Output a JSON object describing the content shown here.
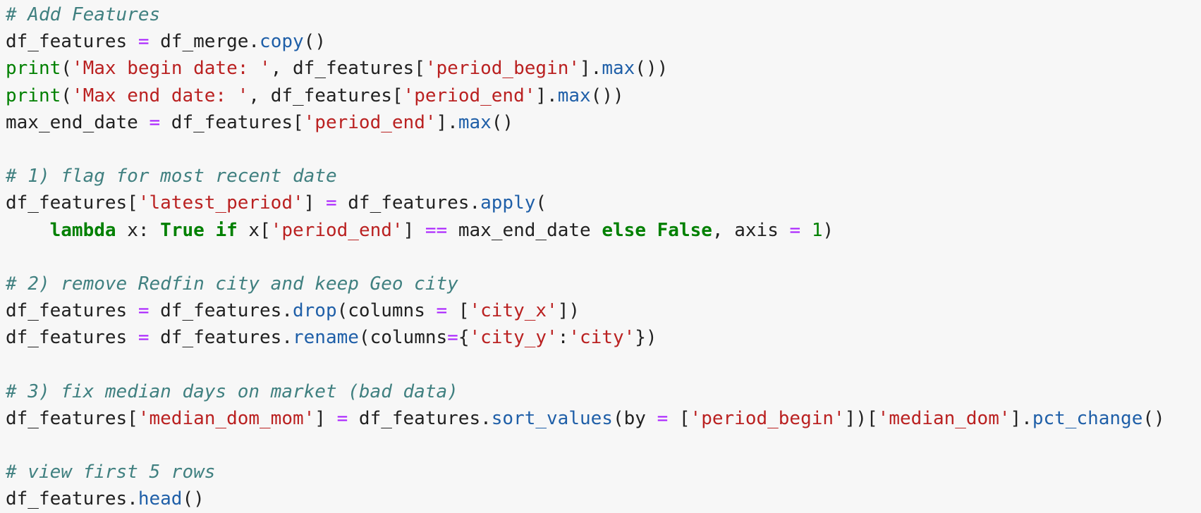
{
  "cell": {
    "lines": [
      [
        {
          "t": "# Add Features",
          "k": "comment"
        }
      ],
      [
        {
          "t": "df_features ",
          "k": "plain"
        },
        {
          "t": "=",
          "k": "operator"
        },
        {
          "t": " df_merge.",
          "k": "plain"
        },
        {
          "t": "copy",
          "k": "method"
        },
        {
          "t": "()",
          "k": "plain"
        }
      ],
      [
        {
          "t": "print",
          "k": "builtin"
        },
        {
          "t": "(",
          "k": "plain"
        },
        {
          "t": "'Max begin date: '",
          "k": "string"
        },
        {
          "t": ", df_features[",
          "k": "plain"
        },
        {
          "t": "'period_begin'",
          "k": "string"
        },
        {
          "t": "].",
          "k": "plain"
        },
        {
          "t": "max",
          "k": "method"
        },
        {
          "t": "())",
          "k": "plain"
        }
      ],
      [
        {
          "t": "print",
          "k": "builtin"
        },
        {
          "t": "(",
          "k": "plain"
        },
        {
          "t": "'Max end date: '",
          "k": "string"
        },
        {
          "t": ", df_features[",
          "k": "plain"
        },
        {
          "t": "'period_end'",
          "k": "string"
        },
        {
          "t": "].",
          "k": "plain"
        },
        {
          "t": "max",
          "k": "method"
        },
        {
          "t": "())",
          "k": "plain"
        }
      ],
      [
        {
          "t": "max_end_date ",
          "k": "plain"
        },
        {
          "t": "=",
          "k": "operator"
        },
        {
          "t": " df_features[",
          "k": "plain"
        },
        {
          "t": "'period_end'",
          "k": "string"
        },
        {
          "t": "].",
          "k": "plain"
        },
        {
          "t": "max",
          "k": "method"
        },
        {
          "t": "()",
          "k": "plain"
        }
      ],
      [],
      [
        {
          "t": "# 1) flag for most recent date",
          "k": "comment"
        }
      ],
      [
        {
          "t": "df_features[",
          "k": "plain"
        },
        {
          "t": "'latest_period'",
          "k": "string"
        },
        {
          "t": "] ",
          "k": "plain"
        },
        {
          "t": "=",
          "k": "operator"
        },
        {
          "t": " df_features.",
          "k": "plain"
        },
        {
          "t": "apply",
          "k": "method"
        },
        {
          "t": "(",
          "k": "plain"
        }
      ],
      [
        {
          "t": "    ",
          "k": "plain"
        },
        {
          "t": "lambda",
          "k": "keyword"
        },
        {
          "t": " x: ",
          "k": "plain"
        },
        {
          "t": "True",
          "k": "keyword"
        },
        {
          "t": " ",
          "k": "plain"
        },
        {
          "t": "if",
          "k": "keyword"
        },
        {
          "t": " x[",
          "k": "plain"
        },
        {
          "t": "'period_end'",
          "k": "string"
        },
        {
          "t": "] ",
          "k": "plain"
        },
        {
          "t": "==",
          "k": "operator"
        },
        {
          "t": " max_end_date ",
          "k": "plain"
        },
        {
          "t": "else",
          "k": "keyword"
        },
        {
          "t": " ",
          "k": "plain"
        },
        {
          "t": "False",
          "k": "keyword"
        },
        {
          "t": ", axis ",
          "k": "plain"
        },
        {
          "t": "=",
          "k": "operator"
        },
        {
          "t": " ",
          "k": "plain"
        },
        {
          "t": "1",
          "k": "number"
        },
        {
          "t": ")",
          "k": "plain"
        }
      ],
      [],
      [
        {
          "t": "# 2) remove Redfin city and keep Geo city",
          "k": "comment"
        }
      ],
      [
        {
          "t": "df_features ",
          "k": "plain"
        },
        {
          "t": "=",
          "k": "operator"
        },
        {
          "t": " df_features.",
          "k": "plain"
        },
        {
          "t": "drop",
          "k": "method"
        },
        {
          "t": "(columns ",
          "k": "plain"
        },
        {
          "t": "=",
          "k": "operator"
        },
        {
          "t": " [",
          "k": "plain"
        },
        {
          "t": "'city_x'",
          "k": "string"
        },
        {
          "t": "])",
          "k": "plain"
        }
      ],
      [
        {
          "t": "df_features ",
          "k": "plain"
        },
        {
          "t": "=",
          "k": "operator"
        },
        {
          "t": " df_features.",
          "k": "plain"
        },
        {
          "t": "rename",
          "k": "method"
        },
        {
          "t": "(columns",
          "k": "plain"
        },
        {
          "t": "=",
          "k": "operator"
        },
        {
          "t": "{",
          "k": "plain"
        },
        {
          "t": "'city_y'",
          "k": "string"
        },
        {
          "t": ":",
          "k": "plain"
        },
        {
          "t": "'city'",
          "k": "string"
        },
        {
          "t": "})",
          "k": "plain"
        }
      ],
      [],
      [
        {
          "t": "# 3) fix median days on market (bad data)",
          "k": "comment"
        }
      ],
      [
        {
          "t": "df_features[",
          "k": "plain"
        },
        {
          "t": "'median_dom_mom'",
          "k": "string"
        },
        {
          "t": "] ",
          "k": "plain"
        },
        {
          "t": "=",
          "k": "operator"
        },
        {
          "t": " df_features.",
          "k": "plain"
        },
        {
          "t": "sort_values",
          "k": "method"
        },
        {
          "t": "(by ",
          "k": "plain"
        },
        {
          "t": "=",
          "k": "operator"
        },
        {
          "t": " [",
          "k": "plain"
        },
        {
          "t": "'period_begin'",
          "k": "string"
        },
        {
          "t": "])[",
          "k": "plain"
        },
        {
          "t": "'median_dom'",
          "k": "string"
        },
        {
          "t": "].",
          "k": "plain"
        },
        {
          "t": "pct_change",
          "k": "method"
        },
        {
          "t": "()",
          "k": "plain"
        }
      ],
      [],
      [
        {
          "t": "# view first 5 rows",
          "k": "comment"
        }
      ],
      [
        {
          "t": "df_features.",
          "k": "plain"
        },
        {
          "t": "head",
          "k": "method"
        },
        {
          "t": "()",
          "k": "plain"
        }
      ]
    ]
  },
  "colors": {
    "background": "#f7f7f7",
    "comment": "#408080",
    "keyword": "#008000",
    "string": "#ba2121",
    "operator": "#aa22ff",
    "method": "#1f5fa8",
    "text": "#212121"
  }
}
